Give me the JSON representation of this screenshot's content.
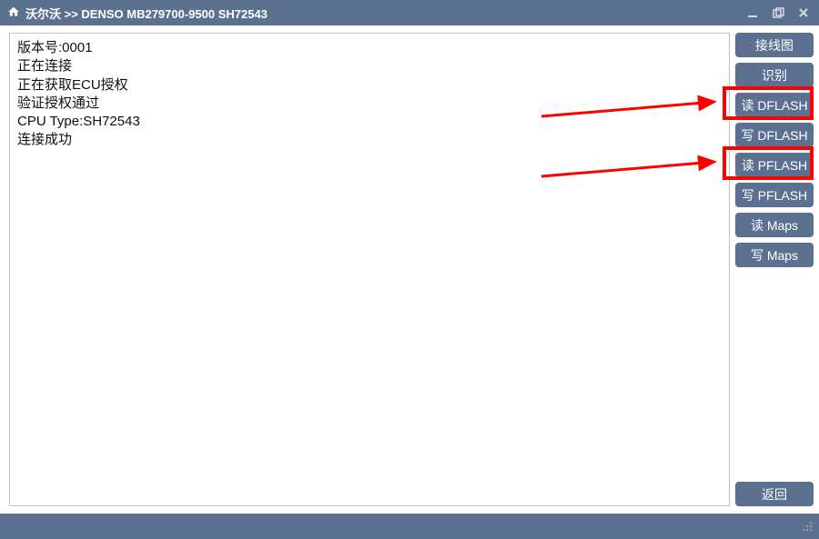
{
  "titlebar": {
    "breadcrumb": "沃尔沃 >> DENSO MB279700-9500 SH72543"
  },
  "log": {
    "lines": [
      "版本号:0001",
      "正在连接",
      "正在获取ECU授权",
      "验证授权通过",
      "CPU Type:SH72543",
      "连接成功"
    ]
  },
  "sidebar": {
    "wiring": "接线图",
    "identify": "识别",
    "read_dflash": "读 DFLASH",
    "write_dflash": "写 DFLASH",
    "read_pflash": "读 PFLASH",
    "write_pflash": "写 PFLASH",
    "read_maps": "读 Maps",
    "write_maps": "写 Maps",
    "back": "返回"
  }
}
